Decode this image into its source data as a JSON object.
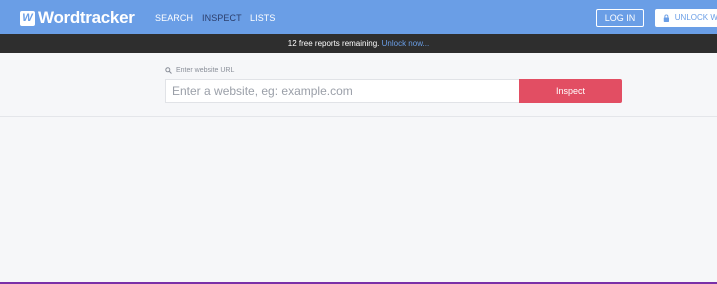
{
  "brand": {
    "logo_mark": "W",
    "name": "Wordtracker"
  },
  "nav": {
    "items": [
      {
        "label": "SEARCH",
        "active": false
      },
      {
        "label": "INSPECT",
        "active": true
      },
      {
        "label": "LISTS",
        "active": false
      }
    ],
    "login_label": "LOG IN",
    "unlock_label": "UNLOCK WIT"
  },
  "banner": {
    "text": "12 free reports remaining.",
    "link": "Unlock now..."
  },
  "search": {
    "label": "Enter website URL",
    "placeholder": "Enter a website, eg: example.com",
    "value": "",
    "button_label": "Inspect"
  },
  "colors": {
    "nav_bg": "#6a9ee6",
    "banner_bg": "#2e2e2e",
    "inspect_button": "#e24e63",
    "page_bg": "#f6f7f9"
  }
}
